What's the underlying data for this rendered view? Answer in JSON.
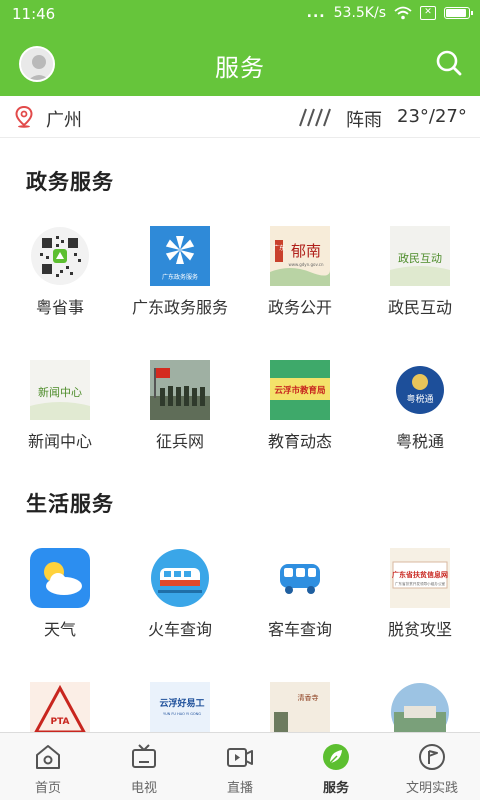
{
  "status_bar": {
    "time": "11:46",
    "dots": "...",
    "speed": "53.5K/s"
  },
  "header": {
    "title": "服务"
  },
  "weather": {
    "city": "广州",
    "condition": "阵雨",
    "temperature": "23°/27°"
  },
  "sections": [
    {
      "title": "政务服务",
      "items": [
        {
          "label": "粤省事",
          "icon": "qr-code-icon"
        },
        {
          "label": "广东政务服务",
          "icon": "gov-service-logo"
        },
        {
          "label": "政务公开",
          "icon": "yunnan-banner"
        },
        {
          "label": "政民互动",
          "icon": "interaction-banner"
        },
        {
          "label": "新闻中心",
          "icon": "news-banner"
        },
        {
          "label": "征兵网",
          "icon": "soldiers-photo"
        },
        {
          "label": "教育动态",
          "icon": "education-banner"
        },
        {
          "label": "粤税通",
          "icon": "tax-badge"
        }
      ]
    },
    {
      "title": "生活服务",
      "items": [
        {
          "label": "天气",
          "icon": "weather-app-icon"
        },
        {
          "label": "火车查询",
          "icon": "train-icon"
        },
        {
          "label": "客车查询",
          "icon": "bus-icon"
        },
        {
          "label": "脱贫攻坚",
          "icon": "poverty-banner"
        }
      ]
    }
  ],
  "partial_thumbs": {
    "thumb_2_text": "云浮好易工",
    "thumb_2_sub": "YUN FU HAO YI GONG",
    "thumb_3_text": "清香寺",
    "thumb_1_text": "PTA"
  },
  "banner_text": {
    "gov_service": "广东政务服务",
    "yunnan_chars": "郁南",
    "yunnan_prefix": "广东",
    "yunnan_url": "www.gdyn.gov.cn",
    "interaction": "政民互动",
    "news": "新闻中心",
    "education": "云浮市教育局",
    "tax": "粤税通",
    "poverty": "广东省扶贫信息网",
    "poverty_sub": "广东省扶贫开发领导小组办公室"
  },
  "nav": [
    {
      "label": "首页",
      "icon": "home-icon",
      "active": false
    },
    {
      "label": "电视",
      "icon": "tv-icon",
      "active": false
    },
    {
      "label": "直播",
      "icon": "live-video-icon",
      "active": false
    },
    {
      "label": "服务",
      "icon": "leaf-service-icon",
      "active": true
    },
    {
      "label": "文明实践",
      "icon": "flag-circle-icon",
      "active": false
    }
  ],
  "colors": {
    "brand_green": "#66c53b",
    "active_green": "#5cbf30"
  }
}
